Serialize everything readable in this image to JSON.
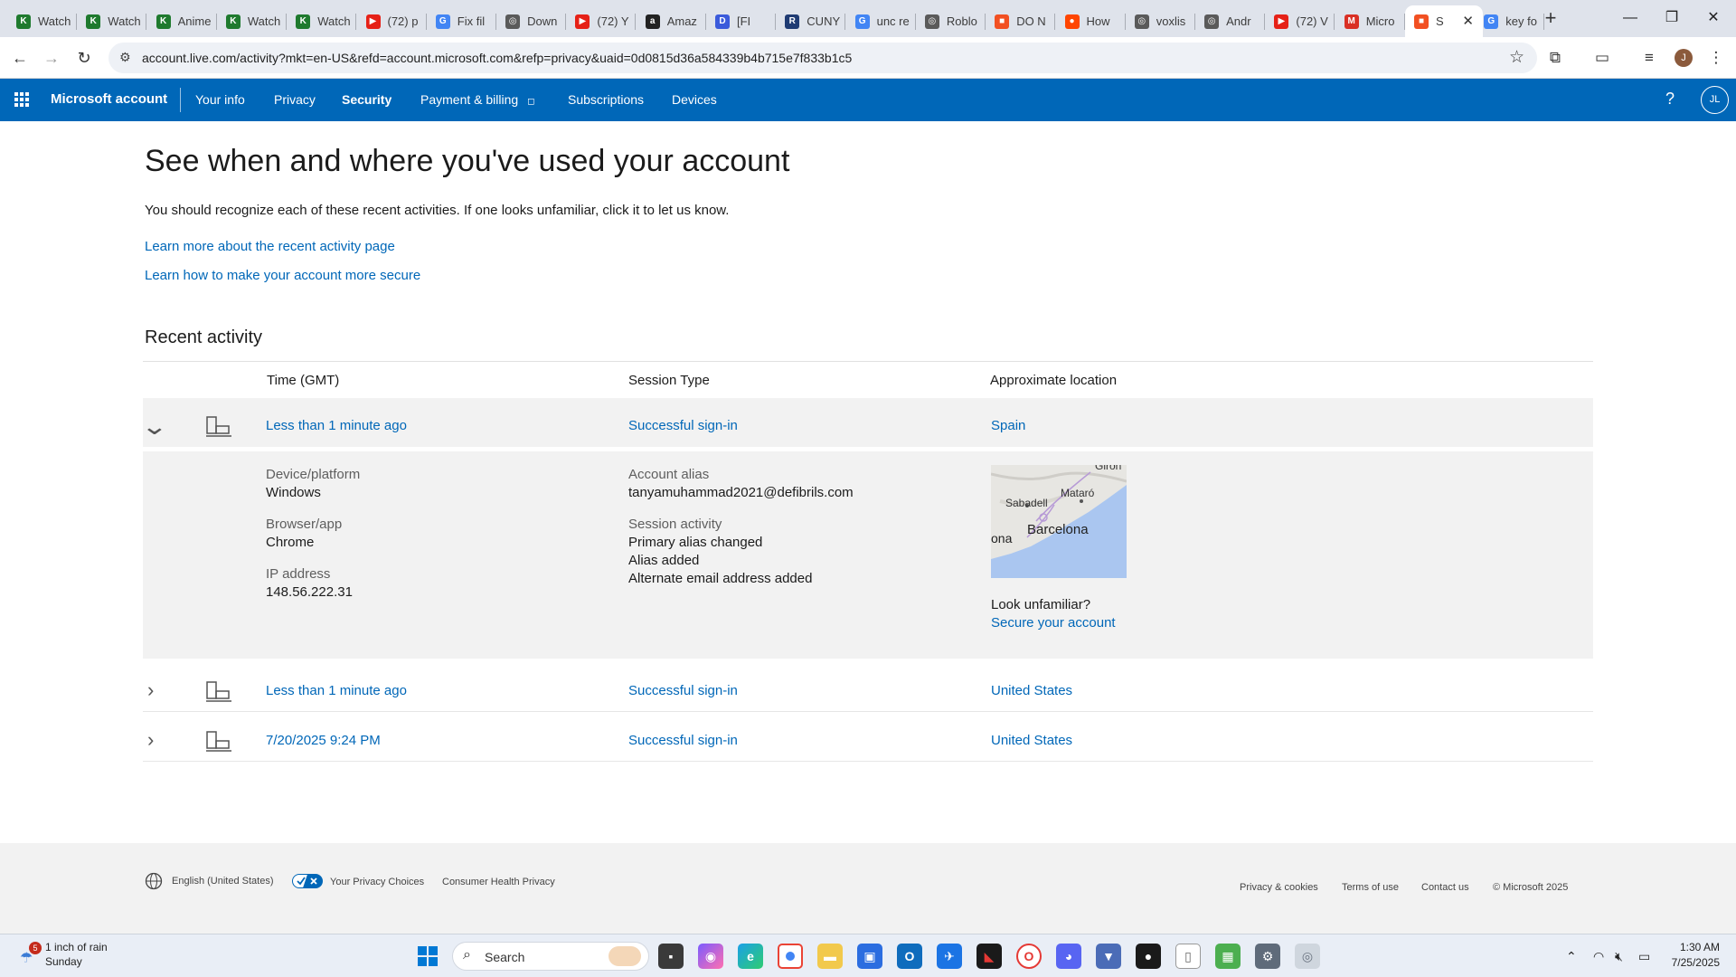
{
  "browser": {
    "tabs": [
      {
        "title": "Watch",
        "fav": "K",
        "color": "#1f7a2e"
      },
      {
        "title": "Watch",
        "fav": "K",
        "color": "#1f7a2e"
      },
      {
        "title": "Anime",
        "fav": "K",
        "color": "#1f7a2e"
      },
      {
        "title": "Watch",
        "fav": "K",
        "color": "#1f7a2e"
      },
      {
        "title": "Watch",
        "fav": "K",
        "color": "#1f7a2e"
      },
      {
        "title": "(72) p",
        "fav": "▶",
        "color": "#e62117"
      },
      {
        "title": "Fix fil",
        "fav": "G",
        "color": "#4285f4"
      },
      {
        "title": "Down",
        "fav": "◎",
        "color": "#5a5a5a"
      },
      {
        "title": "(72) Y",
        "fav": "▶",
        "color": "#e62117"
      },
      {
        "title": "Amaz",
        "fav": "a",
        "color": "#222222"
      },
      {
        "title": "[FI",
        "fav": "D",
        "color": "#3b5bdb"
      },
      {
        "title": "CUNY",
        "fav": "R",
        "color": "#1f3b73"
      },
      {
        "title": "unc re",
        "fav": "G",
        "color": "#4285f4"
      },
      {
        "title": "Roblo",
        "fav": "◎",
        "color": "#5a5a5a"
      },
      {
        "title": "DO N",
        "fav": "■",
        "color": "#f25022"
      },
      {
        "title": "How",
        "fav": "●",
        "color": "#ff4500"
      },
      {
        "title": "voxlis",
        "fav": "◎",
        "color": "#5a5a5a"
      },
      {
        "title": "Andr",
        "fav": "◎",
        "color": "#5a5a5a"
      },
      {
        "title": "(72) V",
        "fav": "▶",
        "color": "#e62117"
      },
      {
        "title": "Micro",
        "fav": "M",
        "color": "#d93025"
      },
      {
        "title": "S",
        "fav": "■",
        "color": "#f25022",
        "active": true
      },
      {
        "title": "key fo",
        "fav": "G",
        "color": "#4285f4"
      }
    ],
    "url": "account.live.com/activity?mkt=en-US&refd=account.microsoft.com&refp=privacy&uaid=0d0815d36a584339b4b715e7f833b1c5",
    "profile_initial": "J"
  },
  "header": {
    "brand": "Microsoft account",
    "nav": [
      "Your info",
      "Privacy",
      "Security",
      "Payment & billing",
      "Subscriptions",
      "Devices"
    ],
    "help": "?",
    "avatar": "JL"
  },
  "page": {
    "title": "See when and where you've used your account",
    "intro": "You should recognize each of these recent activities. If one looks unfamiliar, click it to let us know.",
    "link1": "Learn more about the recent activity page",
    "link2": "Learn how to make your account more secure",
    "section": "Recent activity",
    "columns": {
      "time": "Time (GMT)",
      "session": "Session Type",
      "location": "Approximate location"
    }
  },
  "activities": [
    {
      "time": "Less than 1 minute ago",
      "session": "Successful sign-in",
      "location": "Spain",
      "expanded": true,
      "details": {
        "device_label": "Device/platform",
        "device": "Windows",
        "browser_label": "Browser/app",
        "browser": "Chrome",
        "ip_label": "IP address",
        "ip": "148.56.222.31",
        "alias_label": "Account alias",
        "alias": "tanyamuhammad2021@defibrils.com",
        "activity_label": "Session activity",
        "activity": [
          "Primary alias changed",
          "Alias added",
          "Alternate email address added"
        ],
        "map_labels": [
          "Giron",
          "Mataró",
          "Sabadell",
          "Barcelona",
          "ona"
        ],
        "unfamiliar": "Look unfamiliar?",
        "secure_link": "Secure your account"
      }
    },
    {
      "time": "Less than 1 minute ago",
      "session": "Successful sign-in",
      "location": "United States"
    },
    {
      "time": "7/20/2025 9:24 PM",
      "session": "Successful sign-in",
      "location": "United States"
    }
  ],
  "footer": {
    "language": "English (United States)",
    "privacy_choices": "Your Privacy Choices",
    "health": "Consumer Health Privacy",
    "links": [
      "Privacy & cookies",
      "Terms of use",
      "Contact us",
      "© Microsoft 2025"
    ]
  },
  "taskbar": {
    "weather_badge": "5",
    "weather_title": "1 inch of rain",
    "weather_sub": "Sunday",
    "search_placeholder": "Search",
    "time": "1:30 AM",
    "date": "7/25/2025"
  },
  "colors": {
    "accent": "#0067b8",
    "link": "#0067b8"
  }
}
